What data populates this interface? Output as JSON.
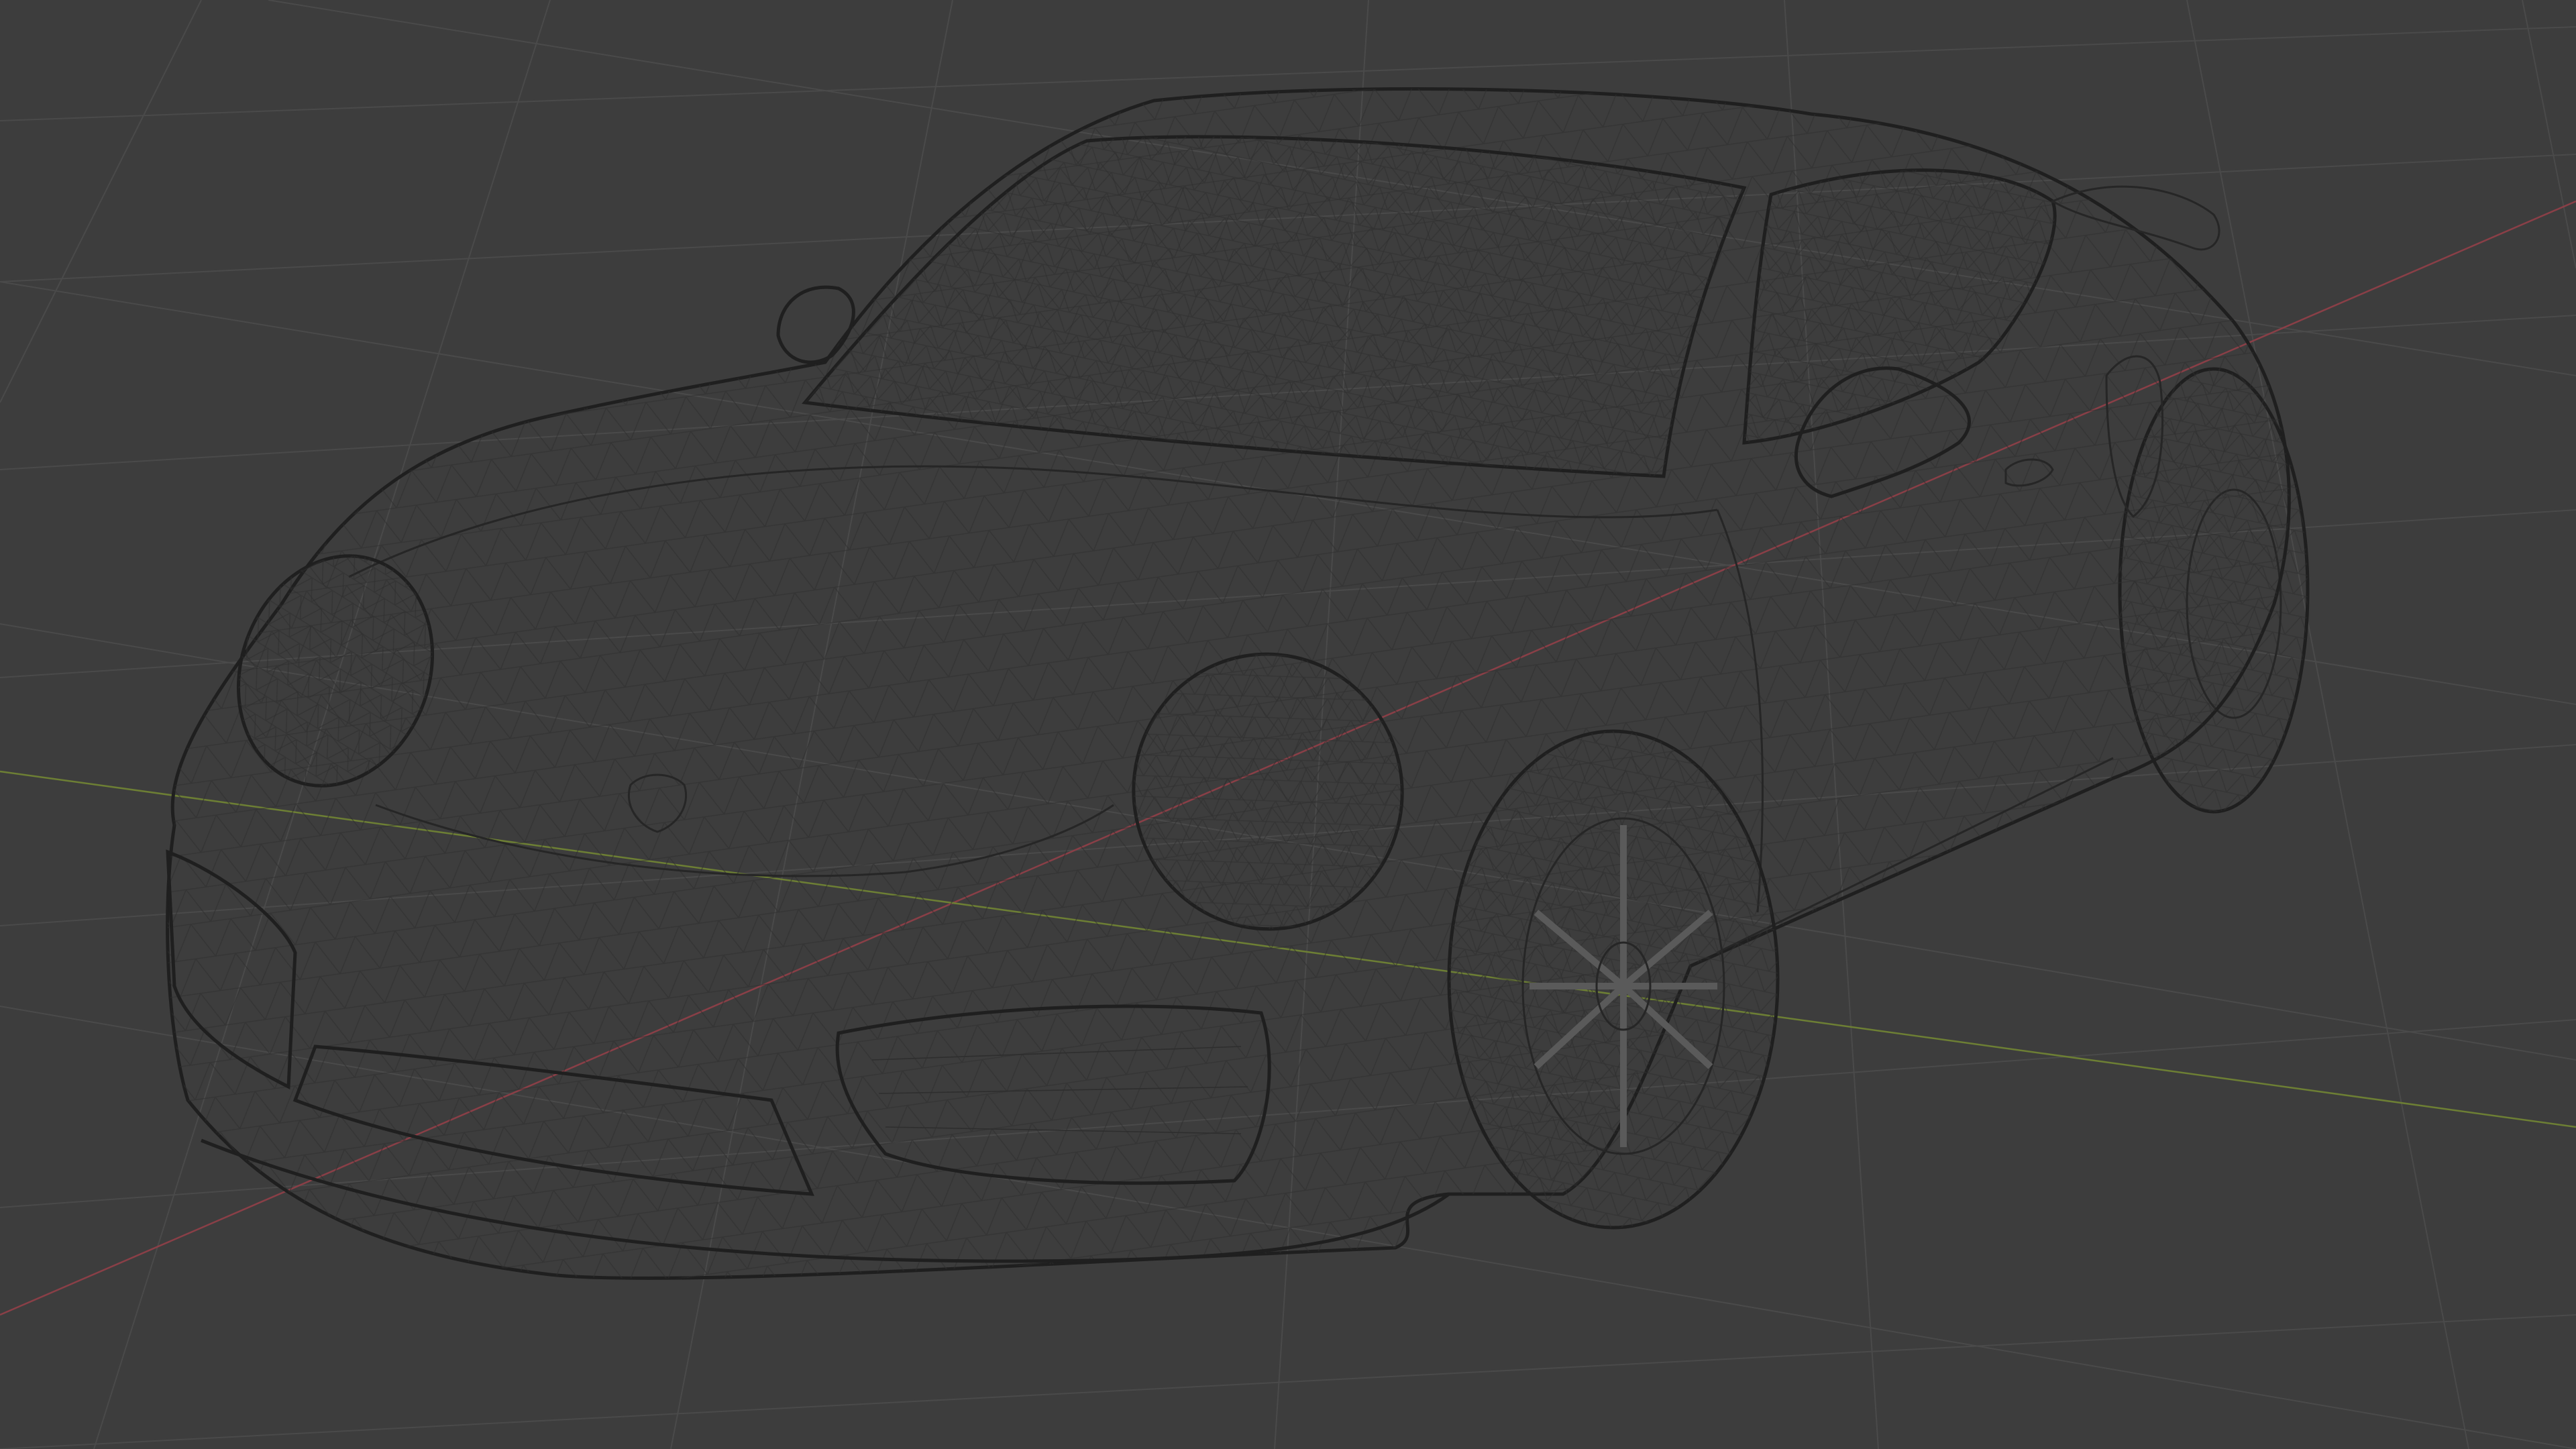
{
  "viewport": {
    "background_color": "#3d3d3d",
    "grid_color": "#4a4a4a",
    "x_axis_color": "#8a3f47",
    "y_axis_color": "#6d7f34",
    "shading_mode": "wireframe-overlay",
    "body_color": "#9a9a9a",
    "wire_color": "#2e2e2e",
    "subject": "car-3d-model"
  }
}
